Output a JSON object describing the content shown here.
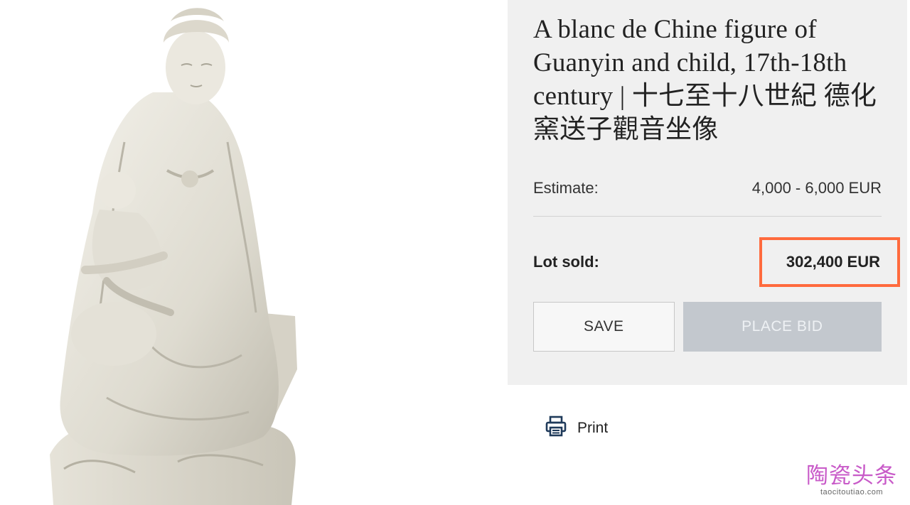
{
  "lot": {
    "title": "A blanc de Chine figure of Guanyin and child, 17th-18th century | 十七至十八世紀 德化窯送子觀音坐像",
    "estimate_label": "Estimate:",
    "estimate_value": "4,000 - 6,000 EUR",
    "sold_label": "Lot sold:",
    "sold_value": "302,400 EUR",
    "highlight_color": "#ff6a3d"
  },
  "actions": {
    "save_label": "SAVE",
    "place_bid_label": "PLACE BID",
    "place_bid_state": "disabled",
    "print_label": "Print",
    "print_icon": "printer-icon"
  },
  "image": {
    "subject": "porcelain-figure-image"
  },
  "watermark": {
    "main": "陶瓷头条",
    "sub": "taocitoutiao.com"
  }
}
